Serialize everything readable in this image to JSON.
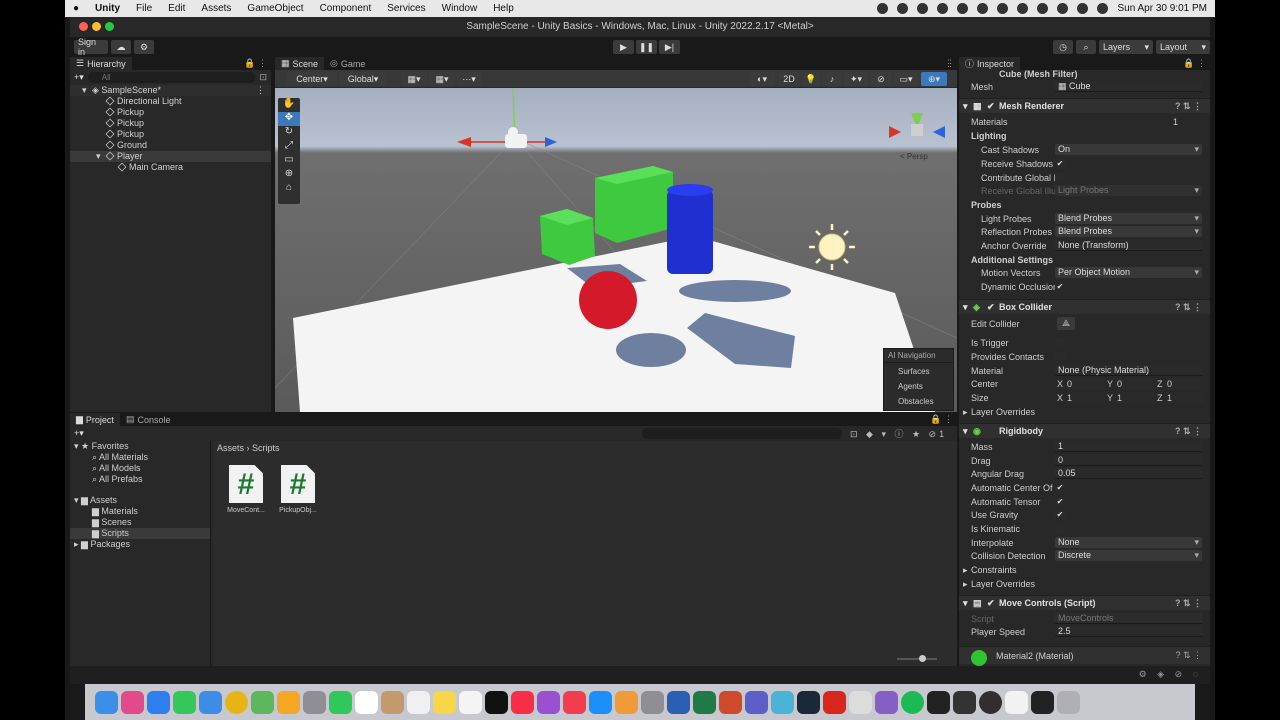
{
  "menubar": {
    "app": "Unity",
    "items": [
      "File",
      "Edit",
      "Assets",
      "GameObject",
      "Component",
      "Services",
      "Window",
      "Help"
    ],
    "clock": "Sun Apr 30  9:01 PM"
  },
  "window": {
    "title": "SampleScene - Unity Basics - Windows, Mac, Linux - Unity 2022.2.17 <Metal>"
  },
  "toolbar": {
    "signin": "Sign in",
    "layers": "Layers",
    "layout": "Layout"
  },
  "hierarchy": {
    "tab": "Hierarchy",
    "search_placeholder": "All",
    "scene": "SampleScene*",
    "items": [
      "Directional Light",
      "Pickup",
      "Pickup",
      "Pickup",
      "Ground",
      "Player",
      "Main Camera"
    ]
  },
  "scene": {
    "tabs": [
      "Scene",
      "Game"
    ],
    "pivot": "Center",
    "space": "Global",
    "mode2d": "2D",
    "persp": "< Persp",
    "ai_nav": {
      "title": "AI Navigation",
      "items": [
        "Surfaces",
        "Agents",
        "Obstacles"
      ]
    }
  },
  "project": {
    "tabs": [
      "Project",
      "Console"
    ],
    "favorites": {
      "label": "Favorites",
      "items": [
        "All Materials",
        "All Models",
        "All Prefabs"
      ]
    },
    "assets": {
      "label": "Assets",
      "items": [
        "Materials",
        "Scenes",
        "Scripts"
      ]
    },
    "packages": "Packages",
    "breadcrumb": [
      "Assets",
      "Scripts"
    ],
    "files": [
      "MoveCont...",
      "PickupObj..."
    ],
    "hidden_count": "1"
  },
  "inspector": {
    "tab": "Inspector",
    "mesh_filter": {
      "title": "Cube (Mesh Filter)",
      "mesh_label": "Mesh",
      "mesh_value": "Cube"
    },
    "mesh_renderer": {
      "title": "Mesh Renderer",
      "materials_label": "Materials",
      "materials_count": "1",
      "lighting": "Lighting",
      "cast_shadows_label": "Cast Shadows",
      "cast_shadows": "On",
      "receive_shadows_label": "Receive Shadows",
      "contribute_gi_label": "Contribute Global Il",
      "receive_gi_label": "Receive Global Illur",
      "receive_gi": "Light Probes",
      "probes": "Probes",
      "light_probes_label": "Light Probes",
      "light_probes": "Blend Probes",
      "reflection_probes_label": "Reflection Probes",
      "reflection_probes": "Blend Probes",
      "anchor_label": "Anchor Override",
      "anchor": "None (Transform)",
      "additional": "Additional Settings",
      "motion_label": "Motion Vectors",
      "motion": "Per Object Motion",
      "dynamic_occlusion_label": "Dynamic Occlusion"
    },
    "box_collider": {
      "title": "Box Collider",
      "edit_label": "Edit Collider",
      "trigger_label": "Is Trigger",
      "contacts_label": "Provides Contacts",
      "material_label": "Material",
      "material": "None (Physic Material)",
      "center_label": "Center",
      "center": {
        "x": "0",
        "y": "0",
        "z": "0"
      },
      "size_label": "Size",
      "size": {
        "x": "1",
        "y": "1",
        "z": "1"
      },
      "overrides_label": "Layer Overrides"
    },
    "rigidbody": {
      "title": "Rigidbody",
      "mass_label": "Mass",
      "mass": "1",
      "drag_label": "Drag",
      "drag": "0",
      "angular_label": "Angular Drag",
      "angular": "0.05",
      "auto_com_label": "Automatic Center Of M",
      "auto_tensor_label": "Automatic Tensor",
      "gravity_label": "Use Gravity",
      "kinematic_label": "Is Kinematic",
      "interpolate_label": "Interpolate",
      "interpolate": "None",
      "collision_label": "Collision Detection",
      "collision": "Discrete",
      "constraints_label": "Constraints",
      "overrides_label": "Layer Overrides"
    },
    "move_controls": {
      "title": "Move Controls (Script)",
      "script_label": "Script",
      "script": "MoveControls",
      "speed_label": "Player Speed",
      "speed": "2.5"
    },
    "material": "Material2 (Material)"
  },
  "colors": {
    "accent": "#3a79bb",
    "green_cube": "#3ec93e",
    "blue_cylinder": "#1f2fd0",
    "red_sphere": "#d41a2a"
  }
}
